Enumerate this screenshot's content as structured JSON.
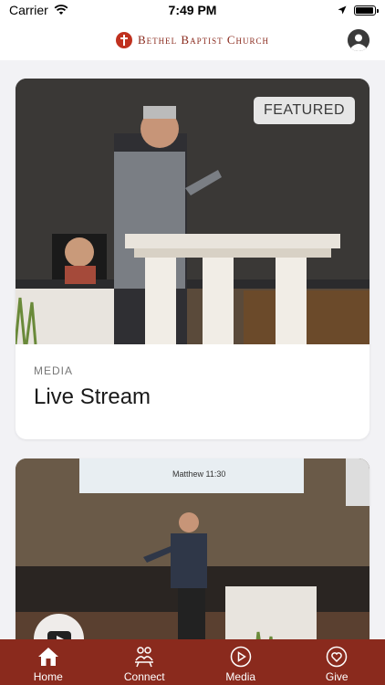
{
  "status": {
    "carrier": "Carrier",
    "time": "7:49 PM",
    "battery": 0.95
  },
  "header": {
    "logo_text": "Bethel Baptist Church"
  },
  "cards": [
    {
      "badge": "FEATURED",
      "kicker": "MEDIA",
      "title": "Live Stream"
    },
    {
      "screen_text": "Matthew 11:30"
    }
  ],
  "tabs": [
    {
      "label": "Home",
      "icon": "home-icon"
    },
    {
      "label": "Connect",
      "icon": "people-icon"
    },
    {
      "label": "Media",
      "icon": "play-circle-icon"
    },
    {
      "label": "Give",
      "icon": "heart-circle-icon"
    }
  ],
  "colors": {
    "brand": "#8a2a1d",
    "background": "#f2f2f5"
  }
}
